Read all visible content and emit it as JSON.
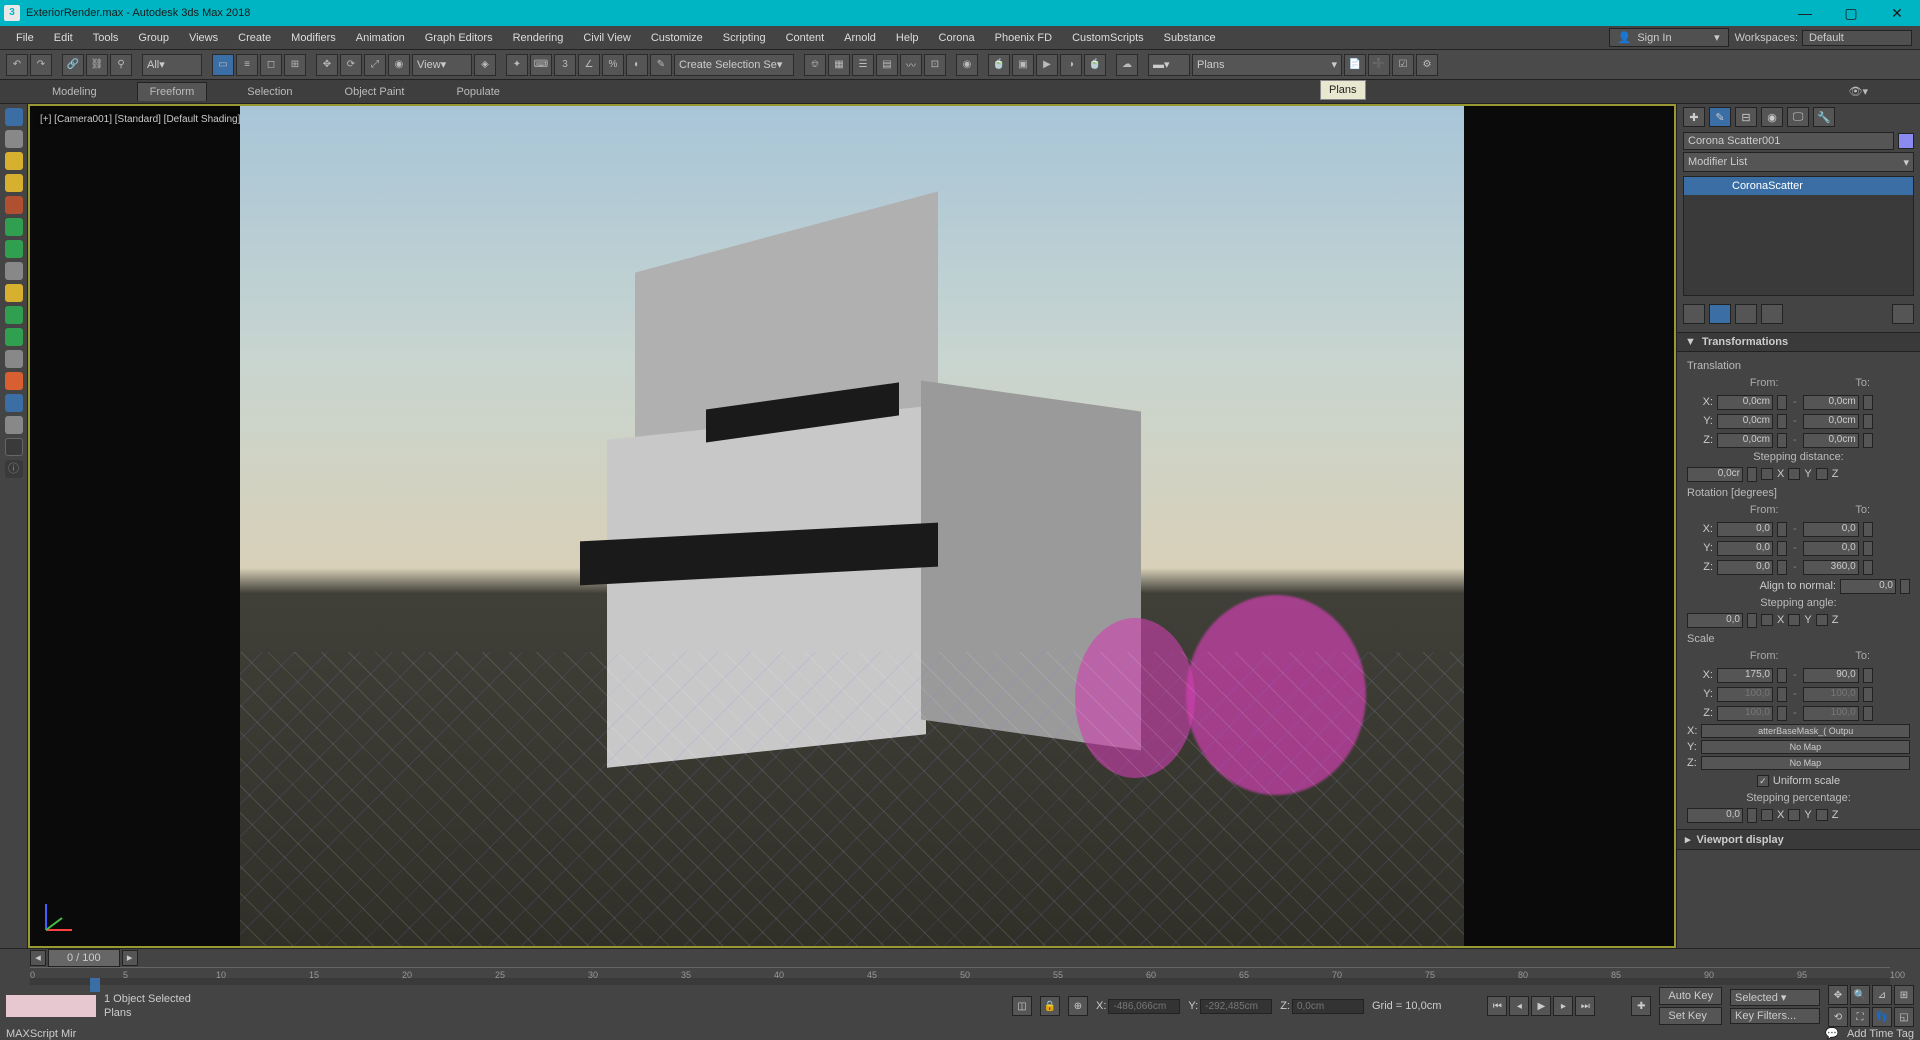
{
  "title": "ExteriorRender.max - Autodesk 3ds Max 2018",
  "menus": [
    "File",
    "Edit",
    "Tools",
    "Group",
    "Views",
    "Create",
    "Modifiers",
    "Animation",
    "Graph Editors",
    "Rendering",
    "Civil View",
    "Customize",
    "Scripting",
    "Content",
    "Arnold",
    "Help",
    "Corona",
    "Phoenix FD",
    "CustomScripts",
    "Substance"
  ],
  "signin": "Sign In",
  "workspaces_label": "Workspaces:",
  "workspaces_value": "Default",
  "toolbar": {
    "all": "All",
    "view": "View",
    "createsel": "Create Selection Se",
    "plans": "Plans"
  },
  "ribbon": [
    "Modeling",
    "Freeform",
    "Selection",
    "Object Paint",
    "Populate"
  ],
  "ribbon_active": 1,
  "tooltip": "Plans",
  "viewport_label": "[+] [Camera001] [Standard] [Default Shading]",
  "panel": {
    "object_name": "Corona Scatter001",
    "modlist_label": "Modifier List",
    "mod_entry": "CoronaScatter",
    "rollout_title": "Transformations",
    "translation": "Translation",
    "from": "From:",
    "to": "To:",
    "trans": {
      "x_from": "0,0cm",
      "x_to": "0,0cm",
      "y_from": "0,0cm",
      "y_to": "0,0cm",
      "z_from": "0,0cm",
      "z_to": "0,0cm"
    },
    "stepping_distance": "Stepping distance:",
    "step_dist_val": "0,0cr",
    "rotation": "Rotation [degrees]",
    "rot": {
      "x_from": "0,0",
      "x_to": "0,0",
      "y_from": "0,0",
      "y_to": "0,0",
      "z_from": "0,0",
      "z_to": "360,0"
    },
    "align_normal": "Align to normal:",
    "align_val": "0,0",
    "stepping_angle": "Stepping angle:",
    "step_ang_val": "0,0",
    "scale": "Scale",
    "sc": {
      "x_from": "175,0",
      "x_to": "90,0",
      "y_from": "100,0",
      "y_to": "100,0",
      "z_from": "100,0",
      "z_to": "100,0"
    },
    "map_x": "atterBaseMask_( Outpu",
    "map_none": "No Map",
    "uniform": "Uniform scale",
    "stepping_pct": "Stepping percentage:",
    "step_pct_val": "0,0",
    "viewport_display": "Viewport display",
    "axes": {
      "x": "X",
      "y": "Y",
      "z": "Z"
    }
  },
  "time": {
    "handle": "0 / 100",
    "ticks": [
      "0",
      "5",
      "10",
      "15",
      "20",
      "25",
      "30",
      "35",
      "40",
      "45",
      "50",
      "55",
      "60",
      "65",
      "70",
      "75",
      "80",
      "85",
      "90",
      "95",
      "100"
    ]
  },
  "status": {
    "selected": "1 Object Selected",
    "plans": "Plans",
    "msbox": "MAXScript Mir",
    "x": "-486,066cm",
    "y": "-292,485cm",
    "z": "0,0cm",
    "grid": "Grid = 10,0cm",
    "addtag": "Add Time Tag",
    "autokey": "Auto Key",
    "setkey": "Set Key",
    "sel": "Selected",
    "keyfilters": "Key Filters..."
  }
}
